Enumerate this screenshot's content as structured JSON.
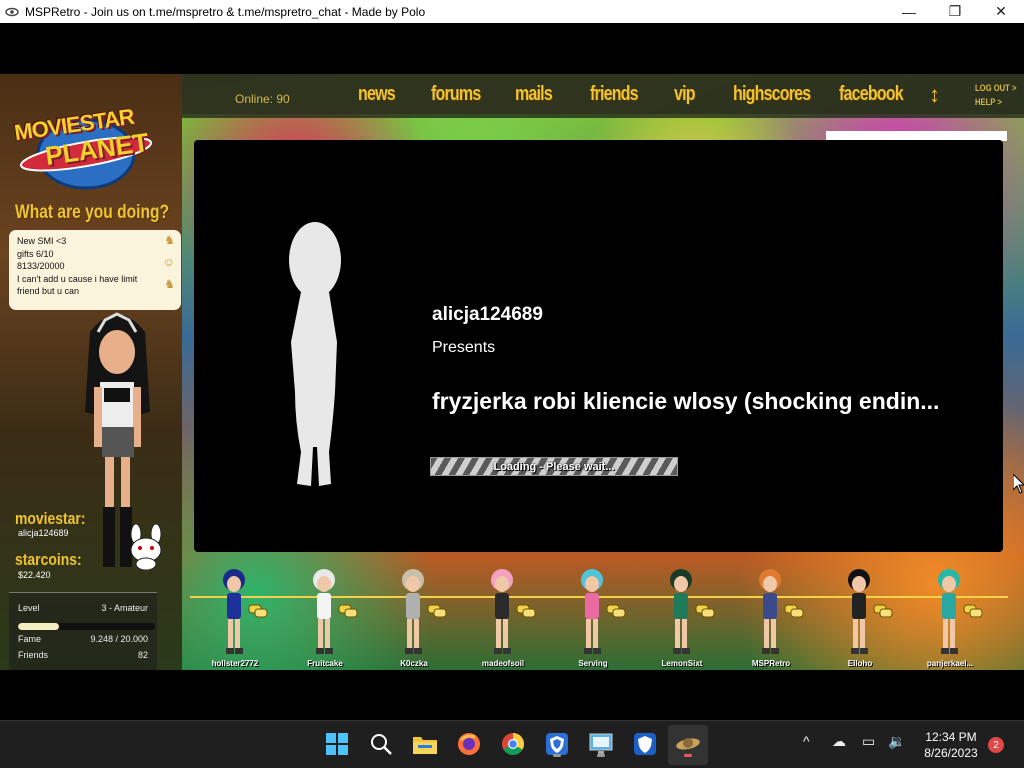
{
  "window": {
    "title": "MSPRetro - Join us on t.me/mspretro & t.me/mspretro_chat - Made by Polo",
    "minimize": "—",
    "maximize": "❐",
    "close": "✕"
  },
  "nav": {
    "online": "Online: 90",
    "items": [
      "news",
      "forums",
      "mails",
      "friends",
      "vip",
      "highscores",
      "facebook"
    ],
    "updown": "↕",
    "logout": "LOG OUT >",
    "help": "HELP >"
  },
  "logo": {
    "line1": "MOVIESTAR",
    "line2": "PLANET"
  },
  "profile": {
    "what_doing": "What are you doing?",
    "status_lines": [
      "New SMI <3",
      "gifts 6/10",
      "8133/20000",
      "I can't add u cause i have limit",
      "friend but u can"
    ],
    "moviestar_label": "moviestar:",
    "moviestar_name": "alicja124689",
    "starcoins_label": "starcoins:",
    "starcoins_value": "$22.420",
    "level_label": "Level",
    "level_value": "3 - Amateur",
    "level_progress": 0.3,
    "fame_label": "Fame",
    "fame_value": "9.248 / 20.000",
    "friends_label": "Friends",
    "friends_value": "82"
  },
  "movie": {
    "creator": "alicja124689",
    "presents": "Presents",
    "title": "fryzjerka robi kliencie wlosy (shocking endin...",
    "loading": "Loading - Please wait..."
  },
  "avatars": [
    {
      "name": "hollster2772",
      "hair": "#1a2a8a",
      "outfit": "#1e2f9a"
    },
    {
      "name": "Fruitcake",
      "hair": "#e8e8e8",
      "outfit": "#f4f4f4"
    },
    {
      "name": "K0czka",
      "hair": "#c8c0a8",
      "outfit": "#b0b0b0"
    },
    {
      "name": "madeofsoil",
      "hair": "#f5a0c0",
      "outfit": "#2a2a2a"
    },
    {
      "name": "Serving",
      "hair": "#4fc3d8",
      "outfit": "#e86aa0"
    },
    {
      "name": "LemonSixt",
      "hair": "#1a3a2a",
      "outfit": "#1f7a5a"
    },
    {
      "name": "MSPRetro",
      "hair": "#e07a30",
      "outfit": "#3a4a8a"
    },
    {
      "name": "Elloho",
      "hair": "#111111",
      "outfit": "#222222"
    },
    {
      "name": "panjerkael...",
      "hair": "#28b8a8",
      "outfit": "#28a8a0"
    }
  ],
  "taskbar": {
    "time": "12:34 PM",
    "date": "8/26/2023",
    "notifications": "2",
    "tray_chevron": "^"
  }
}
